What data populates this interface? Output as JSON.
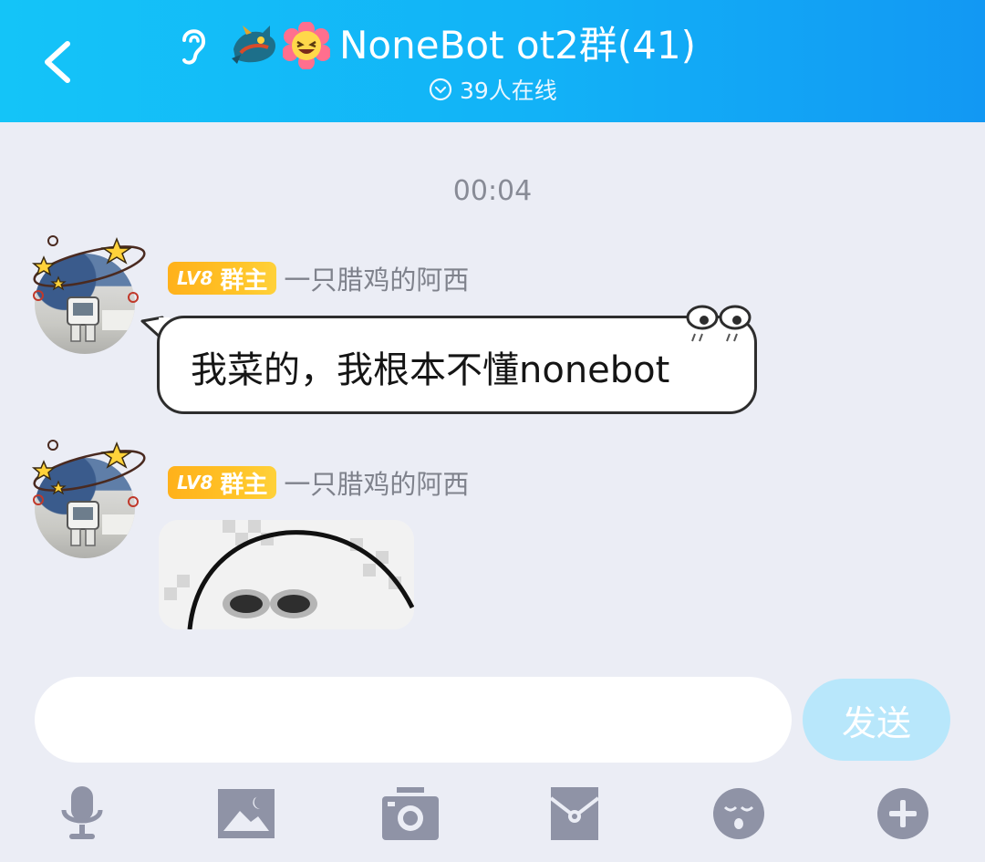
{
  "header": {
    "back_icon": "chevron-left-icon",
    "title": "NoneBot ot2群(41)",
    "online_status": "39人在线",
    "title_icons": [
      "ear-icon",
      "dragon-badge-icon",
      "laughing-face-icon"
    ]
  },
  "chat": {
    "timestamp": "00:04",
    "messages": [
      {
        "level_badge": "LV8",
        "role_badge": "群主",
        "nickname": "一只腊鸡的阿西",
        "text": "我菜的，我根本不懂nonebot",
        "type": "text"
      },
      {
        "level_badge": "LV8",
        "role_badge": "群主",
        "nickname": "一只腊鸡的阿西",
        "type": "sticker",
        "sticker_icon": "pixel-face-sticker"
      }
    ]
  },
  "input": {
    "placeholder": "",
    "send_label": "发送"
  },
  "toolbar": {
    "items": [
      "microphone-icon",
      "image-icon",
      "camera-icon",
      "red-packet-icon",
      "emoji-icon",
      "plus-icon"
    ]
  },
  "colors": {
    "header_start": "#14c4f8",
    "header_end": "#1298f3",
    "background": "#ebedf5",
    "badge": "#ffb11b",
    "send_button": "#b8e7fb",
    "toolbar_icon": "#8f93a6"
  }
}
